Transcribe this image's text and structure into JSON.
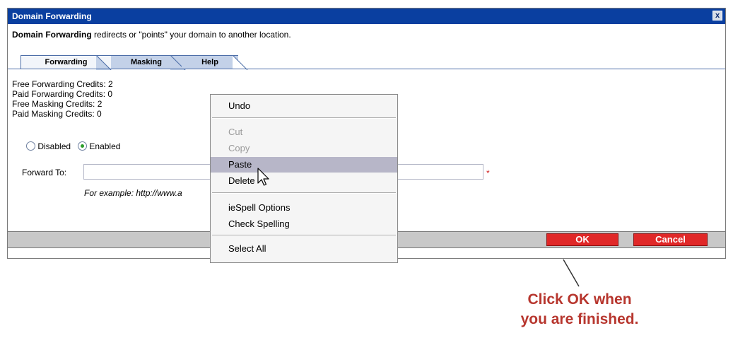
{
  "dialog": {
    "title": "Domain Forwarding",
    "close_label": "x",
    "intro_bold": "Domain Forwarding",
    "intro_rest": " redirects or \"points\" your domain to another location."
  },
  "tabs": [
    {
      "label": "Forwarding",
      "active": true
    },
    {
      "label": "Masking",
      "active": false
    },
    {
      "label": "Help",
      "active": false
    }
  ],
  "credits": [
    "Free Forwarding Credits: 2",
    "Paid Forwarding Credits: 0",
    "Free Masking Credits: 2",
    "Paid Masking Credits: 0"
  ],
  "radios": {
    "disabled_label": "Disabled",
    "enabled_label": "Enabled",
    "selected": "Enabled"
  },
  "forward": {
    "label": "Forward To:",
    "value": "",
    "required_mark": "*",
    "example": "For example: http://www.a"
  },
  "buttons": {
    "ok": "OK",
    "cancel": "Cancel"
  },
  "context_menu": {
    "items": [
      "Undo",
      "Cut",
      "Copy",
      "Paste",
      "Delete",
      "ieSpell Options",
      "Check Spelling",
      "Select All"
    ],
    "disabled": [
      "Cut",
      "Copy"
    ],
    "highlighted": "Paste"
  },
  "callout": {
    "line1": "Click OK when",
    "line2": "you are finished."
  },
  "colors": {
    "titlebar": "#0a3fa0",
    "button": "#e02828",
    "callout": "#b7362e",
    "menu_highlight": "#b7b6c8"
  }
}
